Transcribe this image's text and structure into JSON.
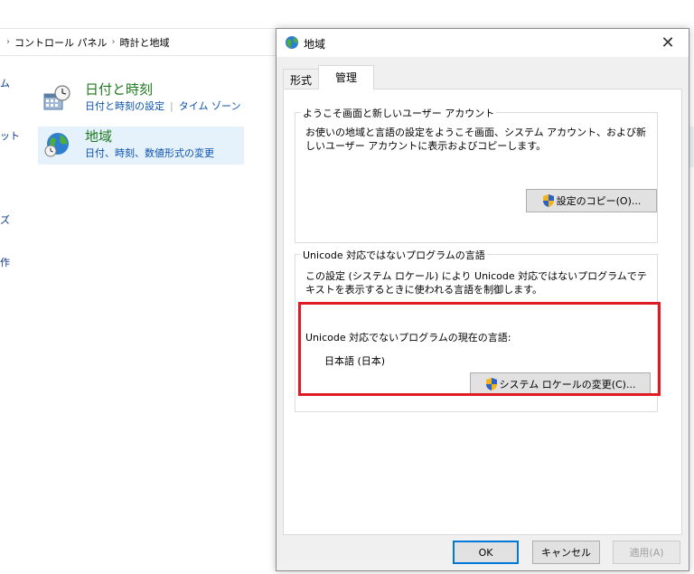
{
  "control_panel": {
    "breadcrumb": [
      "コントロール パネル",
      "時計と地域"
    ],
    "left_items": [
      "ム",
      "ット",
      "ズ",
      "作"
    ],
    "categories": [
      {
        "title": "日付と時刻",
        "links": [
          "日付と時刻の設定",
          "タイム ゾーン"
        ]
      },
      {
        "title": "地域",
        "links": [
          "日付、時刻、数値形式の変更"
        ]
      }
    ]
  },
  "dialog": {
    "title": "地域",
    "close_symbol": "✕",
    "tabs": [
      {
        "label": "形式",
        "active": false
      },
      {
        "label": "管理",
        "active": true
      }
    ],
    "welcome_group": {
      "legend": "ようこそ画面と新しいユーザー アカウント",
      "description": "お使いの地域と言語の設定をようこそ画面、システム アカウント、および新しいユーザー アカウントに表示およびコピーします。",
      "button_label": "設定のコピー(O)..."
    },
    "unicode_group": {
      "legend": "Unicode 対応ではないプログラムの言語",
      "description": "この設定 (システム ロケール) により Unicode 対応ではないプログラムでテキストを表示するときに使われる言語を制御します。",
      "current_label": "Unicode 対応でないプログラムの現在の言語:",
      "current_value": "日本語 (日本)",
      "button_label": "システム ロケールの変更(C)..."
    },
    "buttons": {
      "ok": "OK",
      "cancel": "キャンセル",
      "apply": "適用(A)"
    }
  },
  "colors": {
    "highlight": "#e01b24",
    "category_title": "#1e7a1e",
    "link": "#0b51b0",
    "focus": "#0078d7"
  }
}
